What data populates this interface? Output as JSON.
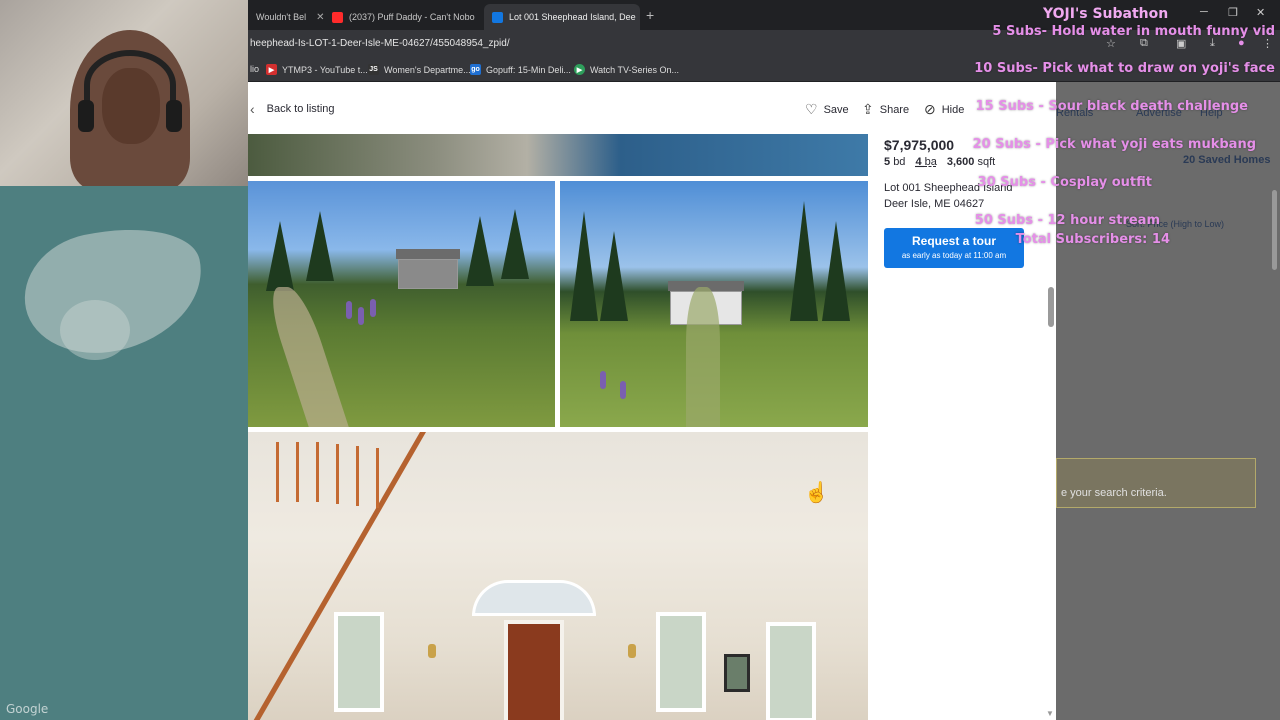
{
  "browser": {
    "tabs": [
      {
        "label": "Wouldn't Bel",
        "active": false,
        "favicon_color": "#e8e8e8"
      },
      {
        "label": "(2037) Puff Daddy - Can't Nobo",
        "active": false,
        "favicon_color": "#ff2b2b"
      },
      {
        "label": "Lot 001 Sheephead Island, Dee",
        "active": true,
        "favicon_color": "#1277e1"
      }
    ],
    "new_tab": "+",
    "url": "heephead-Is-LOT-1-Deer-Isle-ME-04627/455048954_zpid/",
    "bookmarks": [
      {
        "label": "lio",
        "icon": ""
      },
      {
        "label": "YTMP3 - YouTube t...",
        "icon": "▶"
      },
      {
        "label": "Women's Departme...",
        "icon": "JS"
      },
      {
        "label": "Gopuff: 15-Min Deli...",
        "icon": "go"
      },
      {
        "label": "Watch TV-Series On...",
        "icon": "▶"
      }
    ]
  },
  "listing": {
    "back_label": "Back to listing",
    "actions": {
      "save": "Save",
      "share": "Share",
      "hide": "Hide"
    },
    "price": "$7,975,000",
    "beds": "5",
    "beds_unit": "bd",
    "baths": "4",
    "baths_unit": "ba",
    "sqft": "3,600",
    "sqft_unit": "sqft",
    "address_line1": "Lot 001 Sheephead Island",
    "address_line2": "Deer Isle, ME 04627",
    "tour_button": "Request a tour",
    "tour_sub": "as early as today at 11:00 am"
  },
  "right_panel": {
    "saved_homes": "20 Saved Homes",
    "sort": "Sort: Price (High to Low)",
    "nav": [
      "Rentals",
      "Advertise",
      "Help"
    ],
    "search_text": "e your search criteria."
  },
  "overlay": {
    "title": "YOJI's Subathon",
    "lines": [
      "5 Subs- Hold water in mouth funny vid",
      "10 Subs- Pick what to draw on yoji's face",
      "15 Subs - Sour black death challenge",
      "20 Subs - Pick what yoji eats mukbang",
      "30 Subs - Cosplay outfit",
      "50 Subs - 12 hour stream",
      "Total Subscribers: 14"
    ]
  },
  "map": {
    "attribution": "Google"
  },
  "colors": {
    "accent": "#1277e1",
    "overlay_text": "#e58fe8"
  }
}
